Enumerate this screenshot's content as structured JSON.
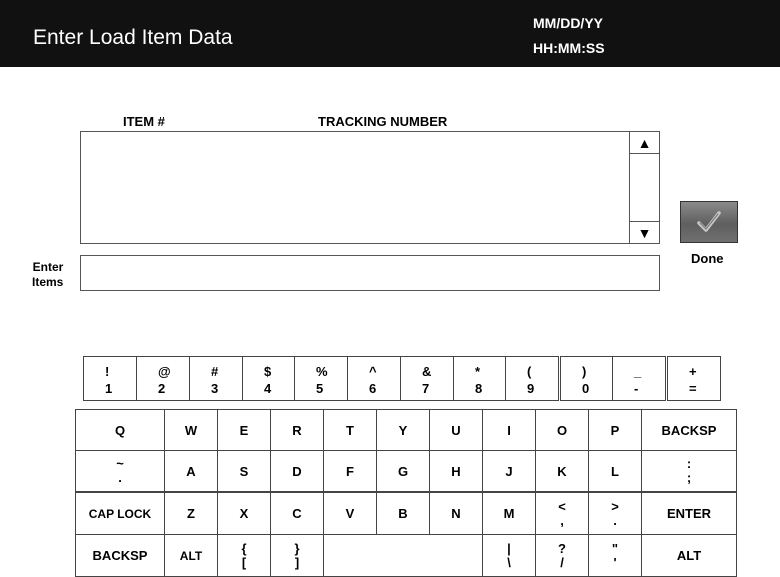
{
  "header": {
    "title": "Enter Load Item Data",
    "date": "MM/DD/YY",
    "time": "HH:MM:SS"
  },
  "list": {
    "col_item": "ITEM #",
    "col_tracking": "TRACKING NUMBER",
    "scroll_up": "▲",
    "scroll_down": "▼"
  },
  "entry": {
    "label_line1": "Enter",
    "label_line2": "Items",
    "value": ""
  },
  "done": {
    "label": "Done",
    "icon": "check-icon"
  },
  "keyboard": {
    "num_row": [
      {
        "top": "!",
        "bottom": "1"
      },
      {
        "top": "@",
        "bottom": "2"
      },
      {
        "top": "#",
        "bottom": "3"
      },
      {
        "top": "$",
        "bottom": "4"
      },
      {
        "top": "%",
        "bottom": "5"
      },
      {
        "top": "^",
        "bottom": "6"
      },
      {
        "top": "&",
        "bottom": "7"
      },
      {
        "top": "*",
        "bottom": "8"
      },
      {
        "top": "(",
        "bottom": "9"
      },
      {
        "top": ")",
        "bottom": "0"
      },
      {
        "top": "_",
        "bottom": "-"
      },
      {
        "top": "+",
        "bottom": "="
      }
    ],
    "row1": [
      "Q",
      "W",
      "E",
      "R",
      "T",
      "Y",
      "U",
      "I",
      "O",
      "P",
      "BACKSP"
    ],
    "row2": {
      "tilde_top": "~",
      "tilde_bottom": ".",
      "letters": [
        "A",
        "S",
        "D",
        "F",
        "G",
        "H",
        "J",
        "K",
        "L"
      ],
      "colon_top": ":",
      "colon_bottom": ";"
    },
    "row3": {
      "caplock": "CAP LOCK",
      "letters": [
        "Z",
        "X",
        "C",
        "V",
        "B",
        "N",
        "M"
      ],
      "lt_top": "<",
      "lt_bottom": ",",
      "gt_top": ">",
      "gt_bottom": ".",
      "enter": "ENTER"
    },
    "row4": {
      "backsp": "BACKSP",
      "alt_left": "ALT",
      "lbrace_top": "{",
      "lbrace_bottom": "[",
      "rbrace_top": "}",
      "rbrace_bottom": "]",
      "pipe_top": "|",
      "pipe_bottom": "\\",
      "q_top": "?",
      "q_bottom": "/",
      "quote_top": "\"",
      "quote_bottom": "'",
      "alt_right": "ALT"
    }
  }
}
